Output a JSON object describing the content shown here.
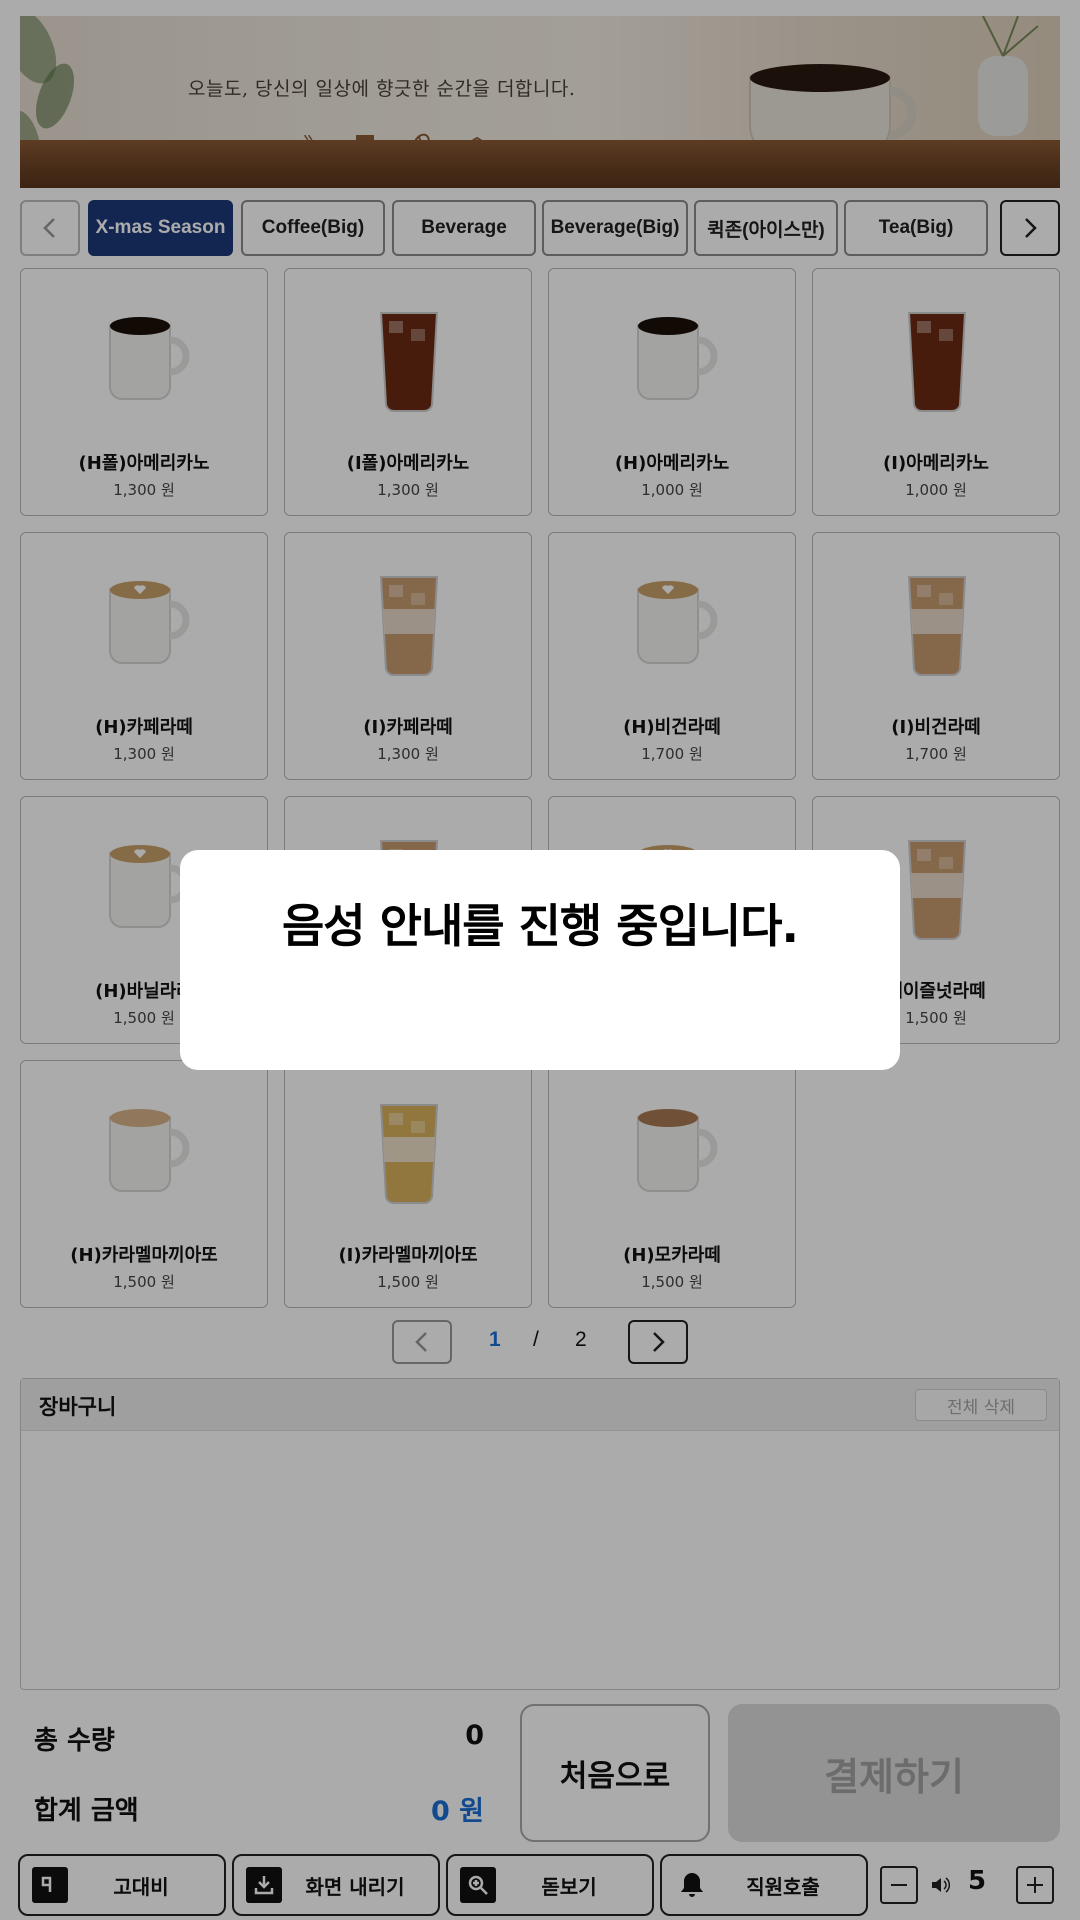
{
  "banner": {
    "tagline": "오늘도, 당신의 일상에 향긋한 순간을 더합니다.",
    "icons": [
      "coffee-cup-icon",
      "takeout-cup-icon",
      "coffee-bean-icon",
      "cake-icon"
    ]
  },
  "categories": {
    "prev_icon": "chevron-left-icon",
    "next_icon": "chevron-right-icon",
    "items": [
      {
        "label": "X-mas Season",
        "active": true
      },
      {
        "label": "Coffee(Big)",
        "active": false
      },
      {
        "label": "Beverage",
        "active": false
      },
      {
        "label": "Beverage(Big)",
        "active": false
      },
      {
        "label": "퀵존(아이스만)",
        "active": false
      },
      {
        "label": "Tea(Big)",
        "active": false
      }
    ]
  },
  "products": [
    {
      "name": "(H폴)아메리카노",
      "price": "1,300 원",
      "image": "hot-americano"
    },
    {
      "name": "(I폴)아메리카노",
      "price": "1,300 원",
      "image": "iced-americano"
    },
    {
      "name": "(H)아메리카노",
      "price": "1,000 원",
      "image": "hot-americano"
    },
    {
      "name": "(I)아메리카노",
      "price": "1,000 원",
      "image": "iced-americano"
    },
    {
      "name": "(H)카페라떼",
      "price": "1,300 원",
      "image": "hot-latte"
    },
    {
      "name": "(I)카페라떼",
      "price": "1,300 원",
      "image": "iced-latte"
    },
    {
      "name": "(H)비건라떼",
      "price": "1,700 원",
      "image": "hot-latte"
    },
    {
      "name": "(I)비건라떼",
      "price": "1,700 원",
      "image": "iced-latte"
    },
    {
      "name": "(H)바닐라라",
      "price": "1,500 원",
      "image": "hot-latte"
    },
    {
      "name": "",
      "price": "",
      "image": "iced-latte"
    },
    {
      "name": "",
      "price": "",
      "image": "hot-latte"
    },
    {
      "name": "헤이즐넛라떼",
      "price": "1,500 원",
      "image": "iced-latte"
    },
    {
      "name": "(H)카라멜마끼아또",
      "price": "1,500 원",
      "image": "hot-macchiato"
    },
    {
      "name": "(I)카라멜마끼아또",
      "price": "1,500 원",
      "image": "iced-macchiato"
    },
    {
      "name": "(H)모카라떼",
      "price": "1,500 원",
      "image": "hot-mocha"
    }
  ],
  "pagination": {
    "current": "1",
    "separator": "/",
    "total": "2"
  },
  "cart": {
    "title": "장바구니",
    "clear_label": "전체 삭제"
  },
  "totals": {
    "qty_label": "총 수량",
    "qty_value": "0",
    "amount_label": "합계 금액",
    "amount_value": "0 원"
  },
  "actions": {
    "home_label": "처음으로",
    "pay_label": "결제하기"
  },
  "accessibility": {
    "high_contrast": "고대비",
    "lower_screen": "화면 내리기",
    "magnifier": "돋보기",
    "staff_call": "직원호출",
    "volume": "5"
  },
  "modal": {
    "message": "음성 안내를 진행 중입니다."
  },
  "colors": {
    "accent": "#1b3a7a",
    "price_blue": "#1a6fd6",
    "pay_disabled": "#dcdcdc"
  }
}
